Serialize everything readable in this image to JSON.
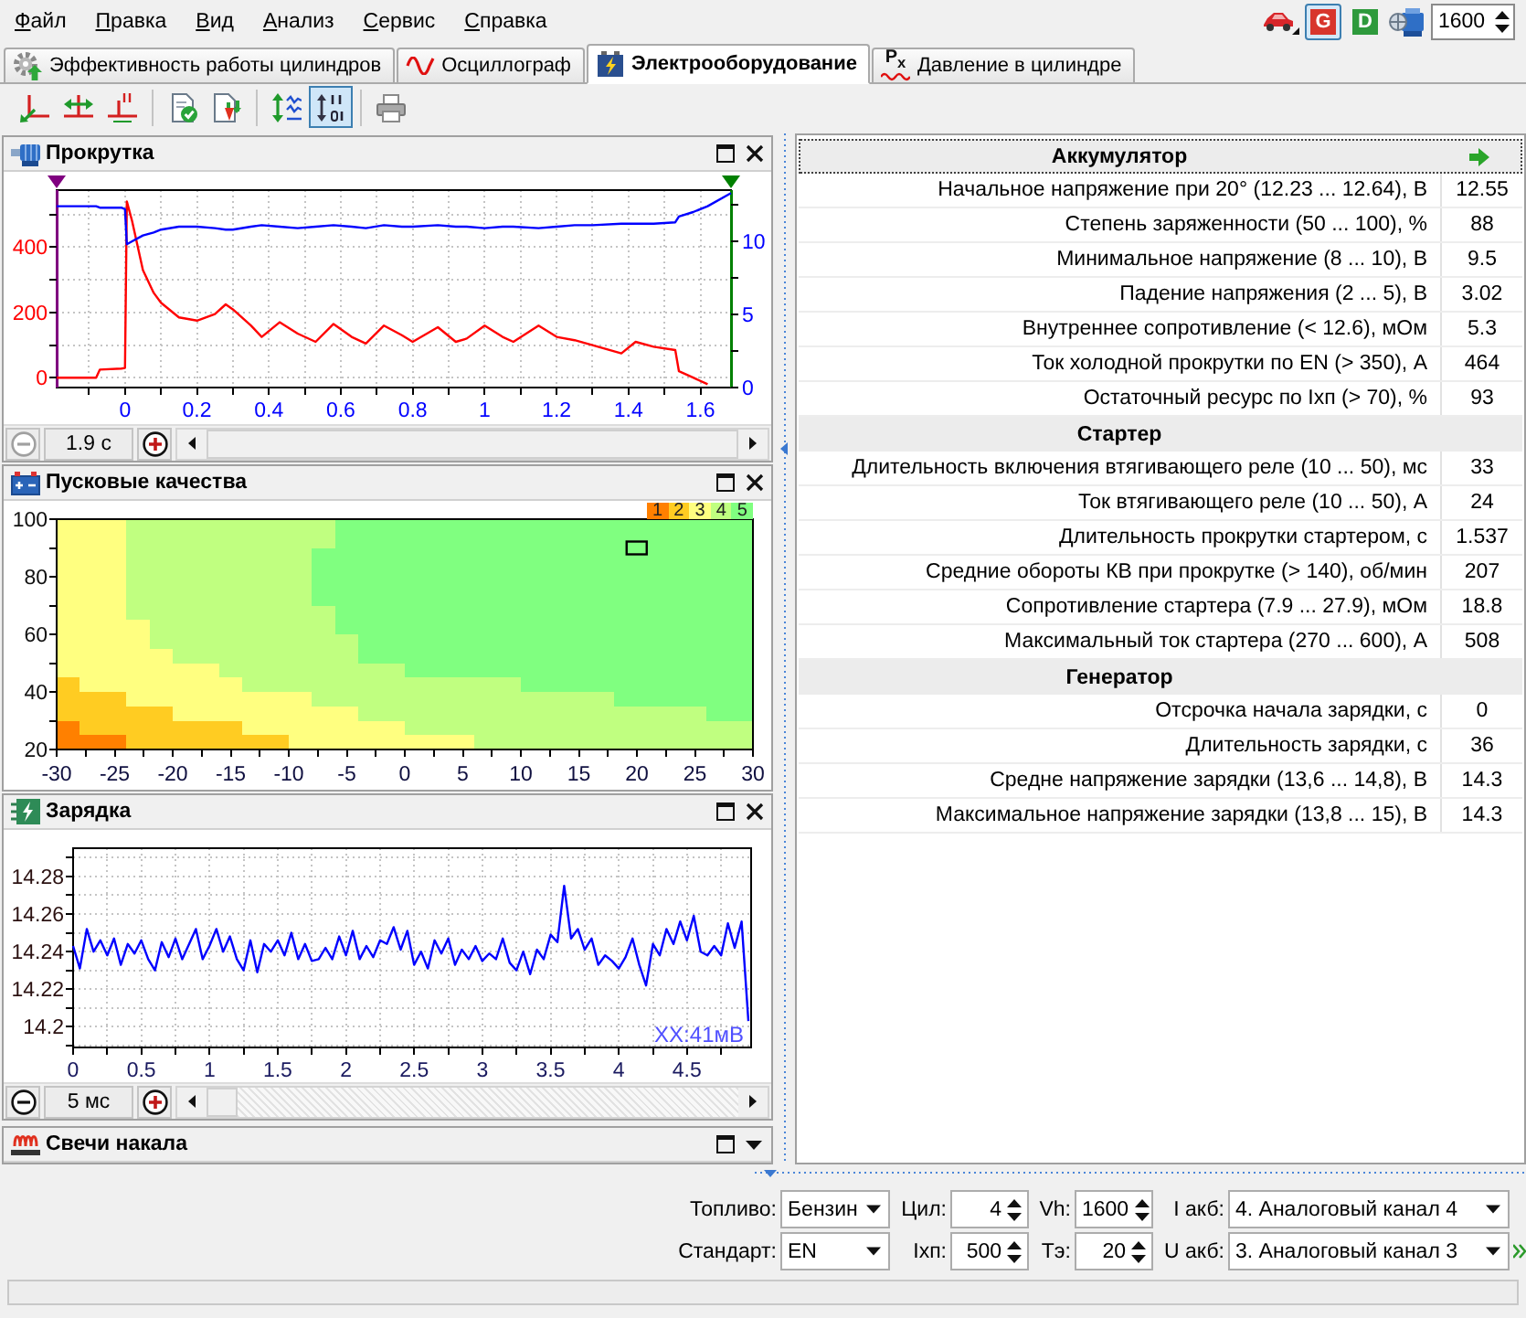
{
  "menu": {
    "items": [
      "Файл",
      "Правка",
      "Вид",
      "Анализ",
      "Сервис",
      "Справка"
    ]
  },
  "quick_controls": {
    "mode_buttons": [
      {
        "label": "G",
        "color": "#d8352c",
        "pressed": true
      },
      {
        "label": "D",
        "color": "#2e9a3c",
        "pressed": false
      }
    ],
    "rpm": {
      "value": "1600"
    }
  },
  "tabs": [
    {
      "label": "Эффективность работы цилиндров",
      "selected": false
    },
    {
      "label": "Осциллограф",
      "selected": false
    },
    {
      "label": "Электрооборудование",
      "selected": true
    },
    {
      "label": "Давление в цилиндре",
      "selected": false,
      "icon_text": "P$_{x}$"
    }
  ],
  "toolbar": {
    "buttons": [
      {
        "pressed": false
      },
      {
        "pressed": false
      },
      {
        "pressed": false
      },
      {
        "pressed": false
      },
      {
        "pressed": false
      },
      {
        "pressed": false
      },
      {
        "pressed": true
      },
      {
        "pressed": false
      }
    ]
  },
  "panels": [
    {
      "kind": "chart",
      "title": "Прокрутка",
      "chart_data": {
        "type": "line",
        "grid": true,
        "x": [
          -0.19,
          -0.08,
          -0.07,
          -0.01,
          0,
          0.005,
          0.02,
          0.05,
          0.08,
          0.1,
          0.15,
          0.2,
          0.25,
          0.28,
          0.3,
          0.35,
          0.38,
          0.43,
          0.48,
          0.53,
          0.58,
          0.63,
          0.67,
          0.72,
          0.77,
          0.8,
          0.87,
          0.92,
          0.95,
          1,
          1.05,
          1.08,
          1.15,
          1.2,
          1.25,
          1.3,
          1.38,
          1.42,
          1.47,
          1.53,
          1.54,
          1.58,
          1.62,
          1.685
        ],
        "xlim": [
          -0.19,
          1.685
        ],
        "ylim": [
          -30,
          575
        ],
        "xticks": [
          0,
          0.2,
          0.4,
          0.6,
          0.8,
          1,
          1.2,
          1.4,
          1.6
        ],
        "yticks": [
          0,
          200,
          400
        ],
        "y2lim": [
          0,
          13.5
        ],
        "y2ticks": [
          0,
          5,
          10
        ],
        "series": [
          {
            "color": "#ff0000",
            "values": [
              0,
              0,
              25,
              28,
              30,
              540,
              480,
              330,
              260,
              230,
              185,
              175,
              195,
              225,
              210,
              160,
              125,
              170,
              135,
              110,
              165,
              125,
              105,
              160,
              130,
              110,
              155,
              110,
              120,
              160,
              125,
              110,
              160,
              125,
              115,
              100,
              75,
              110,
              95,
              85,
              20,
              0,
              -20,
              null
            ]
          },
          {
            "color": "#0000ff",
            "axis": "y2",
            "values": [
              12.4,
              12.4,
              12.3,
              12.3,
              12.2,
              9.8,
              10,
              10.4,
              10.6,
              10.8,
              11,
              11,
              10.9,
              10.8,
              10.8,
              11,
              11.1,
              11,
              10.9,
              11,
              11.1,
              11,
              10.9,
              11.1,
              11,
              11,
              11.1,
              11,
              11,
              10.9,
              11,
              11,
              10.9,
              11,
              11.1,
              11.1,
              11.2,
              11.2,
              11.2,
              11.3,
              11.7,
              12,
              12.4,
              13.3
            ]
          }
        ]
      },
      "time_scale": {
        "value": "1.9 с",
        "zoom_out_disabled": true
      }
    },
    {
      "kind": "zone_map",
      "title": "Пусковые качества",
      "zone_map": {
        "x_labels": [
          "-30",
          "-25",
          "-20",
          "-15",
          "-10",
          "-5",
          "0",
          "5",
          "10",
          "15",
          "20",
          "25",
          "30"
        ],
        "y_labels": [
          "100",
          "80",
          "60",
          "40",
          "20"
        ],
        "legend": [
          {
            "label": "1",
            "color": "#ff8000"
          },
          {
            "label": "2",
            "color": "#ffcc22"
          },
          {
            "label": "3",
            "color": "#ffff80"
          },
          {
            "label": "4",
            "color": "#c0ff80"
          },
          {
            "label": "5",
            "color": "#80ff80"
          }
        ]
      }
    },
    {
      "kind": "chart",
      "title": "Зарядка",
      "chart_data": {
        "type": "line",
        "grid": true,
        "x": [
          0,
          0.05,
          0.1,
          0.15,
          0.2,
          0.25,
          0.3,
          0.35,
          0.4,
          0.45,
          0.5,
          0.55,
          0.6,
          0.65,
          0.7,
          0.75,
          0.8,
          0.85,
          0.9,
          0.95,
          1,
          1.05,
          1.1,
          1.15,
          1.2,
          1.25,
          1.3,
          1.35,
          1.4,
          1.45,
          1.5,
          1.55,
          1.6,
          1.65,
          1.7,
          1.75,
          1.8,
          1.85,
          1.9,
          1.95,
          2,
          2.05,
          2.1,
          2.15,
          2.2,
          2.25,
          2.3,
          2.35,
          2.4,
          2.45,
          2.5,
          2.55,
          2.6,
          2.65,
          2.7,
          2.75,
          2.8,
          2.85,
          2.9,
          2.95,
          3,
          3.05,
          3.1,
          3.15,
          3.2,
          3.25,
          3.3,
          3.35,
          3.4,
          3.45,
          3.5,
          3.55,
          3.6,
          3.65,
          3.7,
          3.75,
          3.8,
          3.85,
          3.9,
          3.95,
          4,
          4.05,
          4.1,
          4.15,
          4.2,
          4.25,
          4.3,
          4.35,
          4.4,
          4.45,
          4.5,
          4.55,
          4.6,
          4.65,
          4.7,
          4.75,
          4.8,
          4.85,
          4.9,
          4.95
        ],
        "xlim": [
          0,
          4.97
        ],
        "ylim": [
          14.189,
          14.295
        ],
        "xticks": [
          0,
          0.5,
          1,
          1.5,
          2,
          2.5,
          3,
          3.5,
          4,
          4.5
        ],
        "yticks": [
          14.2,
          14.22,
          14.24,
          14.26,
          14.28
        ],
        "series": [
          {
            "color": "#0000ff",
            "values": [
              14.243,
              14.231,
              14.252,
              14.24,
              14.246,
              14.238,
              14.247,
              14.233,
              14.244,
              14.239,
              14.246,
              14.236,
              14.23,
              14.245,
              14.237,
              14.247,
              14.236,
              14.244,
              14.252,
              14.236,
              14.243,
              14.252,
              14.24,
              14.248,
              14.236,
              14.23,
              14.246,
              14.229,
              14.244,
              14.24,
              14.246,
              14.238,
              14.25,
              14.236,
              14.244,
              14.235,
              14.236,
              14.242,
              14.236,
              14.248,
              14.238,
              14.251,
              14.236,
              14.243,
              14.237,
              14.246,
              14.244,
              14.253,
              14.241,
              14.251,
              14.233,
              14.24,
              14.231,
              14.246,
              14.239,
              14.247,
              14.233,
              14.241,
              14.236,
              14.243,
              14.235,
              14.239,
              14.236,
              14.247,
              14.234,
              14.23,
              14.24,
              14.228,
              14.241,
              14.236,
              14.249,
              14.245,
              14.275,
              14.247,
              14.252,
              14.241,
              14.247,
              14.233,
              14.238,
              14.235,
              14.231,
              14.237,
              14.247,
              14.233,
              14.222,
              14.244,
              14.238,
              14.252,
              14.244,
              14.256,
              14.246,
              14.259,
              14.24,
              14.238,
              14.243,
              14.238,
              14.255,
              14.242,
              14.256,
              14.203
            ]
          }
        ],
        "annotations": [
          "ХХ:41мВ"
        ]
      },
      "time_scale": {
        "value": "5 мс",
        "zoom_out_disabled": false
      }
    },
    {
      "kind": "collapsed",
      "title": "Свечи накала"
    }
  ],
  "results": {
    "sections": [
      {
        "title": "Аккумулятор",
        "focused": true,
        "rows": [
          {
            "label": "Начальное напряжение при 20° (12.23 ... 12.64), В",
            "value": "12.55"
          },
          {
            "label": "Степень заряженности (50 ... 100), %",
            "value": "88"
          },
          {
            "label": "Минимальное напряжение (8 ... 10), В",
            "value": "9.5"
          },
          {
            "label": "Падение напряжения (2 ... 5), В",
            "value": "3.02"
          },
          {
            "label": "Внутреннее сопротивление (< 12.6), мОм",
            "value": "5.3"
          },
          {
            "label": "Ток холодной прокрутки по EN (> 350), А",
            "value": "464"
          },
          {
            "label": "Остаточный ресурс по Iхп (> 70), %",
            "value": "93"
          }
        ]
      },
      {
        "title": "Стартер",
        "focused": false,
        "rows": [
          {
            "label": "Длительность включения втягивающего реле (10 ... 50), мс",
            "value": "33"
          },
          {
            "label": "Ток втягивающего реле (10 ... 50), А",
            "value": "24"
          },
          {
            "label": "Длительность прокрутки стартером, с",
            "value": "1.537"
          },
          {
            "label": "Средние обороты КВ при прокрутке (> 140), об/мин",
            "value": "207"
          },
          {
            "label": "Сопротивление стартера (7.9 ... 27.9), мОм",
            "value": "18.8"
          },
          {
            "label": "Максимальный ток стартера (270 ... 600), А",
            "value": "508"
          }
        ]
      },
      {
        "title": "Генератор",
        "focused": false,
        "rows": [
          {
            "label": "Отсрочка начала зарядки, с",
            "value": "0"
          },
          {
            "label": "Длительность зарядки, с",
            "value": "36"
          },
          {
            "label": "Средне напряжение зарядки (13,6 ... 14,8), В",
            "value": "14.3"
          },
          {
            "label": "Максимальное напряжение зарядки (13,8 ... 15), В",
            "value": "14.3"
          }
        ]
      }
    ]
  },
  "settings": {
    "rows": [
      [
        {
          "label": "Топливо:",
          "kind": "select",
          "value": "Бензин"
        },
        {
          "label": "Цил:",
          "kind": "spin",
          "value": "4"
        },
        {
          "label": "Vh:",
          "kind": "spin",
          "value": "1600"
        },
        {
          "label": "I акб:",
          "kind": "select",
          "value": "4. Аналоговый канал 4"
        }
      ],
      [
        {
          "label": "Стандарт:",
          "kind": "select",
          "value": "EN"
        },
        {
          "label": "Iхп:",
          "kind": "spin",
          "value": "500"
        },
        {
          "label": "Тэ:",
          "kind": "spin",
          "value": "20"
        },
        {
          "label": "U акб:",
          "kind": "select",
          "value": "3. Аналоговый канал 3"
        }
      ]
    ]
  }
}
